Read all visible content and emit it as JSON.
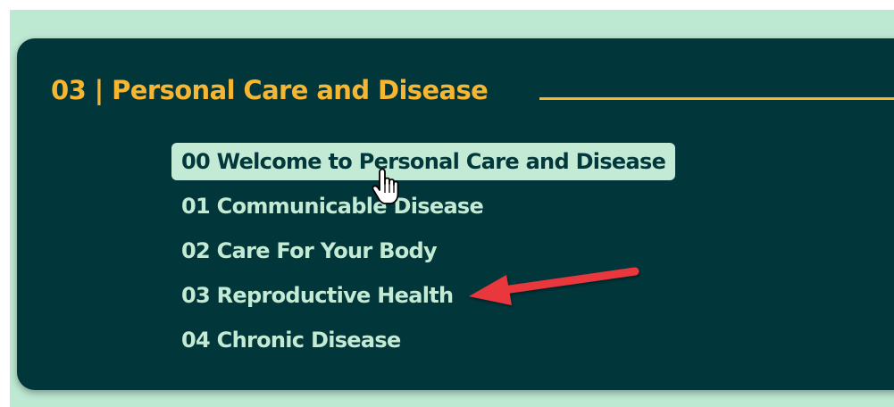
{
  "section": {
    "title": "03 | Personal Care and Disease"
  },
  "lessons": [
    {
      "label": "00 Welcome to Personal Care and Disease",
      "active": true
    },
    {
      "label": "01 Communicable Disease",
      "active": false
    },
    {
      "label": "02 Care For Your Body",
      "active": false
    },
    {
      "label": "03 Reproductive Health",
      "active": false
    },
    {
      "label": "04 Chronic Disease",
      "active": false
    }
  ],
  "colors": {
    "page_background": "#bde8d2",
    "card_background": "#01363a",
    "accent": "#f7b631",
    "item_text": "#c3ead4",
    "highlight_background": "#c3ead4",
    "annotation_arrow": "#e8373e"
  },
  "icons": {
    "cursor": "pointer-hand-icon",
    "annotation": "red-arrow-annotation-icon"
  }
}
